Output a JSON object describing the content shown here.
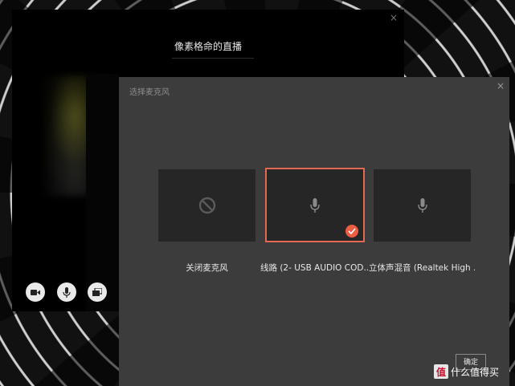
{
  "live_window": {
    "title": "像素格命的直播",
    "close_glyph": "×"
  },
  "controls": {
    "camera_icon": "video-camera-icon",
    "mic_icon": "microphone-icon",
    "screen_icon": "window-share-icon"
  },
  "dialog": {
    "title": "选择麦克风",
    "close_glyph": "×",
    "options": [
      {
        "label": "关闭麦克风",
        "icon": "ban-icon",
        "selected": false
      },
      {
        "label": "线路 (2- USB AUDIO  COD...",
        "icon": "microphone-icon",
        "selected": true
      },
      {
        "label": "立体声混音 (Realtek High ...",
        "icon": "microphone-icon",
        "selected": false
      }
    ],
    "ok_label": "确定"
  },
  "watermark": {
    "badge": "值",
    "text": "什么值得买"
  },
  "colors": {
    "accent": "#ec5d43",
    "dialog_bg": "#3c3c3c",
    "card_bg": "#262626"
  }
}
